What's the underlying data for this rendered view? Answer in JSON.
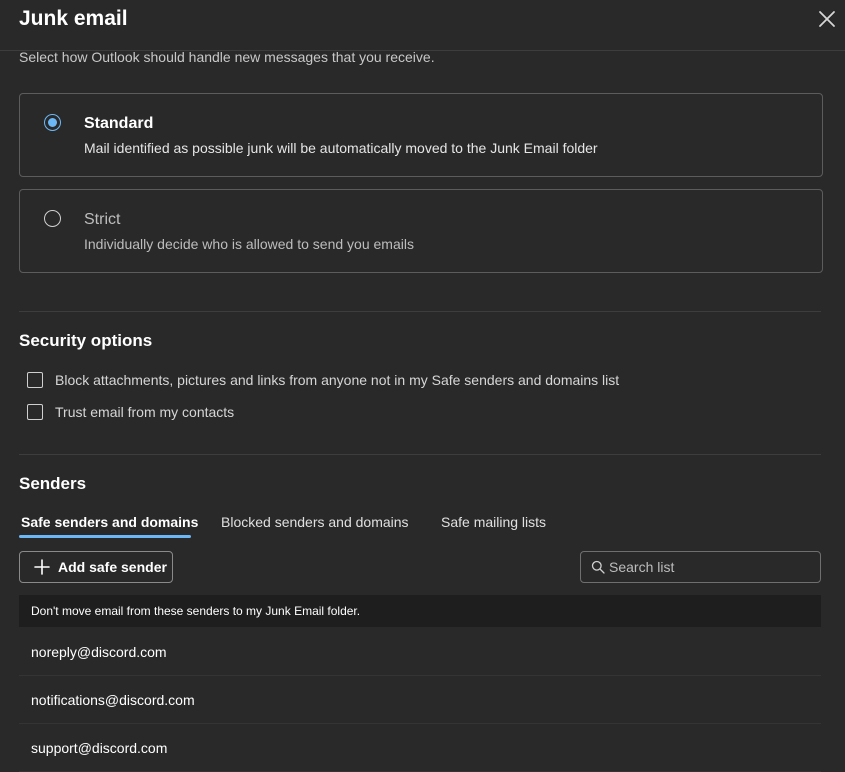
{
  "dialog": {
    "title": "Junk email",
    "subtitle": "Select how Outlook should handle new messages that you receive."
  },
  "filter_options": [
    {
      "label": "Standard",
      "description": "Mail identified as possible junk will be automatically moved to the Junk Email folder",
      "selected": true
    },
    {
      "label": "Strict",
      "description": "Individually decide who is allowed to send you emails",
      "selected": false
    }
  ],
  "security": {
    "title": "Security options",
    "options": [
      {
        "label": "Block attachments, pictures and links from anyone not in my Safe senders and domains list",
        "checked": false
      },
      {
        "label": "Trust email from my contacts",
        "checked": false
      }
    ]
  },
  "senders": {
    "title": "Senders",
    "tabs": [
      {
        "label": "Safe senders and domains",
        "active": true
      },
      {
        "label": "Blocked senders and domains",
        "active": false
      },
      {
        "label": "Safe mailing lists",
        "active": false
      }
    ],
    "add_button_label": "Add safe sender",
    "search_placeholder": "Search list",
    "list_header": "Don't move email from these senders to my Junk Email folder.",
    "items": [
      "noreply@discord.com",
      "notifications@discord.com",
      "support@discord.com"
    ]
  },
  "colors": {
    "background": "#292929",
    "accent": "#6cb8f6",
    "list_header_bg": "#1e1e1e",
    "border": "#5c5c5c"
  },
  "icons": [
    "close-icon",
    "plus-icon",
    "search-icon"
  ]
}
